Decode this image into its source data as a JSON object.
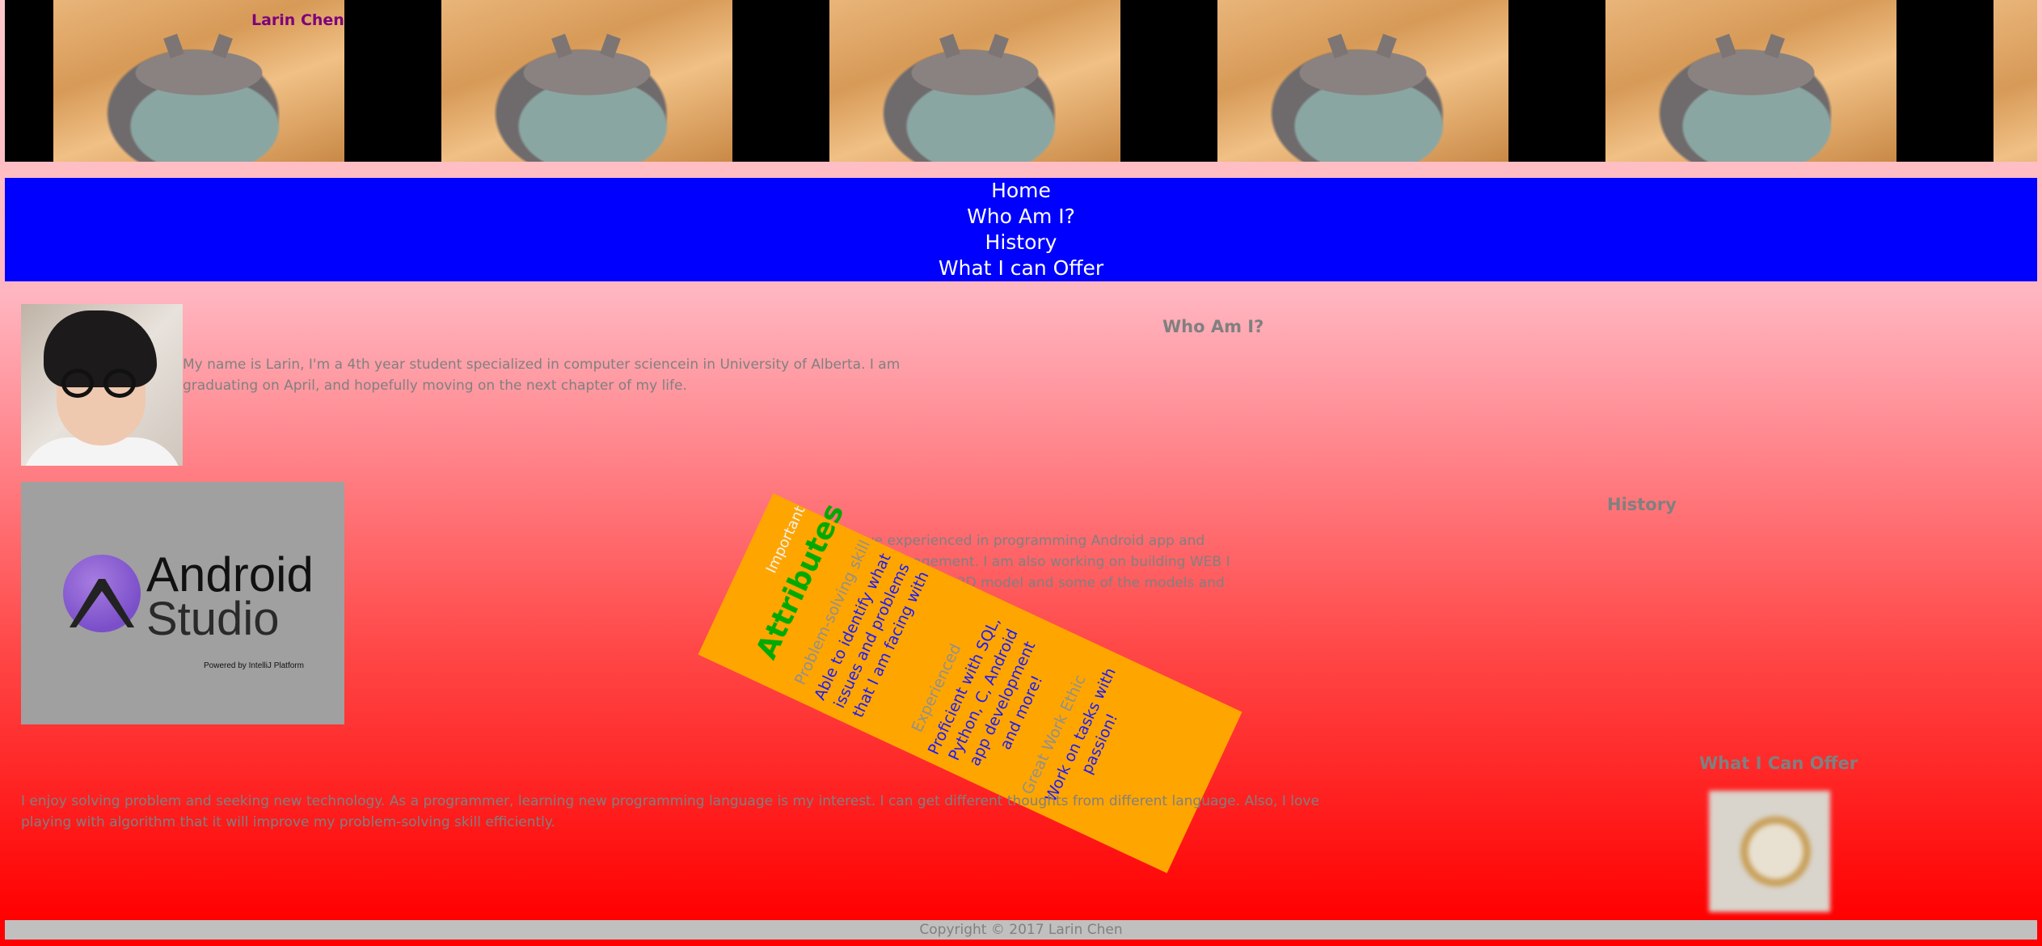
{
  "banner": {
    "title": "Larin Chen",
    "tile_count": 6
  },
  "nav": {
    "items": [
      {
        "label": "Home"
      },
      {
        "label": "Who Am I?"
      },
      {
        "label": "History"
      },
      {
        "label": "What I can Offer"
      }
    ]
  },
  "who": {
    "heading": "Who Am I?",
    "text": "My name is Larin, I'm a 4th year student specialized in computer sciencein in University of Alberta. I am graduating on April, and hopefully moving on the next chapter of my life."
  },
  "history": {
    "heading": "History",
    "logo_word1": "Android",
    "logo_word2": "Studio",
    "logo_powered": "Powered by IntelliJ Platform",
    "text": "I have experienced in programming Android app and some management. I am also working on building WEB I am familiar with 3D model and some of the models and"
  },
  "attributes": {
    "important": "Important",
    "title": "Attributes",
    "problem_solving": {
      "title": "Problem-solving skill",
      "desc": "Able to identify what issues and problems that I am facing with"
    },
    "experienced": {
      "title": "Experienced",
      "desc": "Proficient with SQL, Python, C, Android app development and more!"
    },
    "work_ethic": {
      "title": "Great Work Ethic",
      "desc": "Work on tasks with passion!"
    }
  },
  "offer": {
    "heading": "What I Can Offer",
    "text": "I enjoy solving problem and seeking new technology. As a programmer, learning new programming language is my interest. I can get different thoughts from different language. Also, I love playing with algorithm that it will improve my problem-solving skill efficiently."
  },
  "footer": {
    "text": "Copyright © 2017 Larin Chen"
  },
  "colors": {
    "nav_bg": "#0000ff",
    "attributes_bg": "#ffa500",
    "attributes_title": "#00aa00",
    "attributes_desc": "#1a1aff",
    "body_text": "#808080",
    "banner_title": "#7d007d"
  }
}
